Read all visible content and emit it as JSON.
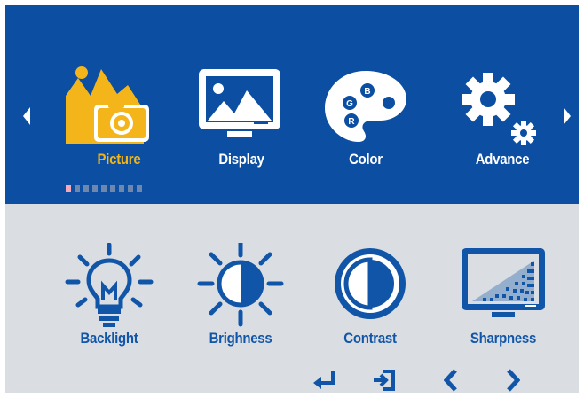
{
  "colors": {
    "header_bg": "#0b4ea2",
    "body_bg": "#dadde2",
    "selected": "#f3b51a",
    "icon_blue": "#1055a8",
    "white": "#ffffff"
  },
  "header": {
    "prev_icon": "triangle-left-icon",
    "next_icon": "triangle-right-icon",
    "categories": [
      {
        "label": "Picture",
        "icon": "picture-icon",
        "selected": true
      },
      {
        "label": "Display",
        "icon": "display-icon",
        "selected": false
      },
      {
        "label": "Color",
        "icon": "color-palette-icon",
        "selected": false
      },
      {
        "label": "Advance",
        "icon": "gears-icon",
        "selected": false
      }
    ],
    "pager": {
      "total": 9,
      "active": 1
    }
  },
  "submenu": {
    "items": [
      {
        "label": "Backlight",
        "icon": "lightbulb-icon"
      },
      {
        "label": "Brighness",
        "icon": "brightness-icon"
      },
      {
        "label": "Contrast",
        "icon": "contrast-icon"
      },
      {
        "label": "Sharpness",
        "icon": "sharpness-icon"
      }
    ]
  },
  "nav_buttons": [
    {
      "icon": "enter-icon"
    },
    {
      "icon": "exit-icon"
    },
    {
      "icon": "left-icon"
    },
    {
      "icon": "right-icon"
    }
  ]
}
